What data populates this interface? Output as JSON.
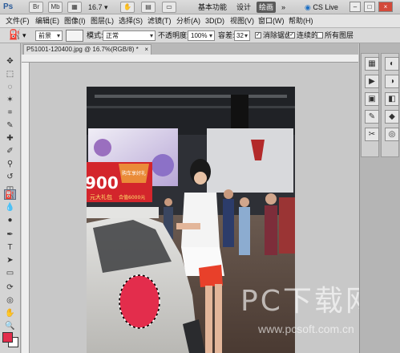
{
  "app": {
    "logo": "Ps",
    "bridge_label": "Br",
    "minibridge_label": "Mb",
    "zoom_value": "16.7",
    "zoom_dropdown_arrow": "▾",
    "workspaces": {
      "basic": "基本功能",
      "design": "设计",
      "paint": "绘画",
      "more": "»"
    },
    "cs_live": "CS Live",
    "window_controls": {
      "minimize": "–",
      "restore": "□",
      "close": "×"
    }
  },
  "menu": {
    "items": [
      "文件(F)",
      "编辑(E)",
      "图像(I)",
      "图层(L)",
      "选择(S)",
      "滤镜(T)",
      "分析(A)",
      "3D(D)",
      "视图(V)",
      "窗口(W)",
      "帮助(H)"
    ]
  },
  "options": {
    "mode_preset": "前景",
    "mode_label": "模式:",
    "mode_value": "正常",
    "opacity_label": "不透明度:",
    "opacity_value": "100%",
    "tolerance_label": "容差:",
    "tolerance_value": "32",
    "antialias_label": "消除锯齿",
    "contiguous_label": "连续的",
    "all_layers_label": "所有图层",
    "antialias_checked": "✓",
    "contiguous_checked": "✓"
  },
  "document": {
    "tab_title": "P51001-120400.jpg @ 16.7%(RGB/8) *",
    "tab_close": "×"
  },
  "colors": {
    "foreground": "#e32d4c",
    "background": "#ffffff"
  },
  "banner": {
    "number": "900",
    "slogan_1": "购车享好礼",
    "slogan_2": "元大礼包",
    "slogan_3": "合值6000元"
  },
  "watermark": {
    "title": "PC下载网",
    "url": "www.pcsoft.com.cn"
  }
}
